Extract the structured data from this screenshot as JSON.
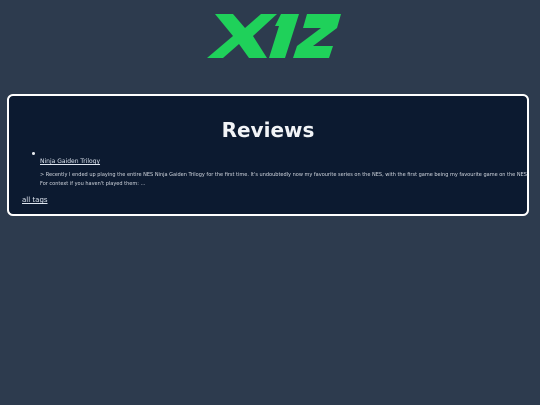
{
  "header": {
    "logo_text": "X12",
    "logo_color": "#1fd15a"
  },
  "main": {
    "title": "Reviews",
    "reviews": [
      {
        "title": "Ninja Gaiden Trilogy",
        "excerpt": "> Recently I ended up playing the entire NES Ninja Gaiden Trilogy for the first time. It's undoubtedly now my favourite series on the NES, with the first game being my favourite game on the NES. For context if you haven't played them: …"
      }
    ],
    "all_tags_label": "all tags"
  }
}
